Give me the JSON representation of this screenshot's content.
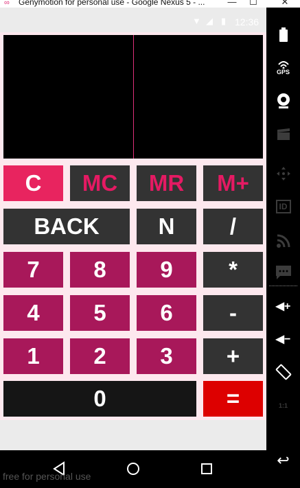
{
  "window": {
    "title": "Genymotion for personal use - Google Nexus 5 - ...",
    "logo_glyph": "∞",
    "minimize_glyph": "—",
    "maximize_glyph": "☐",
    "close_glyph": "✕"
  },
  "status_bar": {
    "time": "12:36",
    "wifi_glyph": "▼",
    "signal_glyph": "◢",
    "battery_glyph": "▮"
  },
  "calculator": {
    "rows": [
      [
        {
          "label": "C",
          "name": "clear-button",
          "style": "k-clear"
        },
        {
          "label": "MC",
          "name": "memory-clear-button",
          "style": "k-mem"
        },
        {
          "label": "MR",
          "name": "memory-recall-button",
          "style": "k-mem"
        },
        {
          "label": "M+",
          "name": "memory-add-button",
          "style": "k-mem"
        }
      ],
      [
        {
          "label": "BACK",
          "name": "backspace-button",
          "style": "k-dark"
        },
        {
          "label": "N",
          "name": "negate-button",
          "style": "k-dark"
        },
        {
          "label": "/",
          "name": "divide-button",
          "style": "k-dark"
        }
      ],
      [
        {
          "label": "7",
          "name": "digit-7-button",
          "style": "k-num"
        },
        {
          "label": "8",
          "name": "digit-8-button",
          "style": "k-num"
        },
        {
          "label": "9",
          "name": "digit-9-button",
          "style": "k-num"
        },
        {
          "label": "*",
          "name": "multiply-button",
          "style": "k-dark"
        }
      ],
      [
        {
          "label": "4",
          "name": "digit-4-button",
          "style": "k-num"
        },
        {
          "label": "5",
          "name": "digit-5-button",
          "style": "k-num"
        },
        {
          "label": "6",
          "name": "digit-6-button",
          "style": "k-num"
        },
        {
          "label": "-",
          "name": "subtract-button",
          "style": "k-dark"
        }
      ],
      [
        {
          "label": "1",
          "name": "digit-1-button",
          "style": "k-num"
        },
        {
          "label": "2",
          "name": "digit-2-button",
          "style": "k-num"
        },
        {
          "label": "3",
          "name": "digit-3-button",
          "style": "k-num"
        },
        {
          "label": "+",
          "name": "add-button",
          "style": "k-dark"
        }
      ],
      [
        {
          "label": "0",
          "name": "digit-0-button",
          "style": "k-zero"
        },
        {
          "label": "=",
          "name": "equals-button",
          "style": "k-eq"
        }
      ]
    ]
  },
  "nav_bar": {
    "back_glyph": "◁",
    "home_glyph": "○",
    "recents_glyph": "□"
  },
  "watermark": "free for personal use",
  "sidebar": {
    "battery_glyph": "▮",
    "gps_label": "GPS",
    "camera_glyph": "◉",
    "id_label": "ID",
    "scale_label": "1:1",
    "volume_up_glyph": "◀+",
    "volume_down_glyph": "◀−",
    "rotate_glyph": "⟲",
    "back_glyph": "↩"
  },
  "colors": {
    "accent": "#e8245f",
    "number_key": "#a8185a",
    "operator_key": "#333333",
    "equals_key": "#dd0000",
    "app_background": "#fde8ee"
  }
}
